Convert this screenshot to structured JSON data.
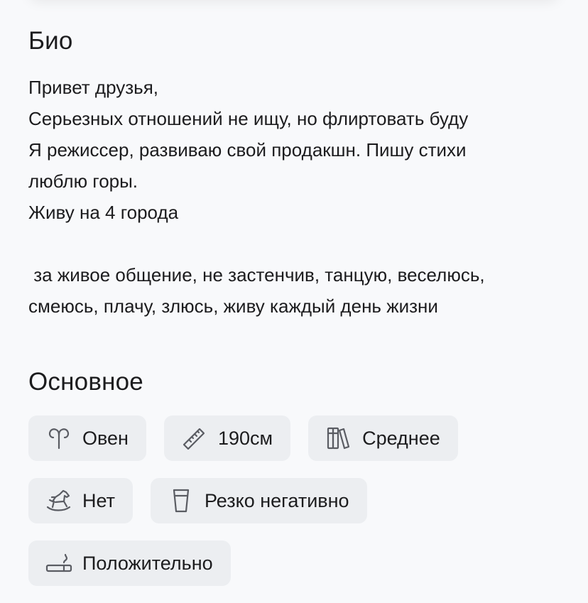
{
  "bio": {
    "title": "Био",
    "lines": [
      "Привет друзья,",
      "Серьезных отношений не ищу, но флиртовать буду",
      "Я режиссер, развиваю свой продакшн. Пишу стихи",
      "люблю горы.",
      "Живу на 4 города",
      "",
      " за живое общение, не застенчив, танцую, веселюсь,",
      "смеюсь, плачу, злюсь, живу каждый день жизни"
    ]
  },
  "main": {
    "title": "Основное",
    "chips": [
      {
        "icon": "aries-icon",
        "label": "Овен"
      },
      {
        "icon": "ruler-icon",
        "label": "190см"
      },
      {
        "icon": "books-icon",
        "label": "Среднее"
      },
      {
        "icon": "rocking-horse-icon",
        "label": "Нет"
      },
      {
        "icon": "glass-icon",
        "label": "Резко негативно"
      },
      {
        "icon": "cigarette-icon",
        "label": "Положительно"
      }
    ]
  },
  "colors": {
    "background": "#f8f9fb",
    "chip_background": "#eceef1",
    "text": "#1c1c1e",
    "icon": "#5a5c63"
  }
}
